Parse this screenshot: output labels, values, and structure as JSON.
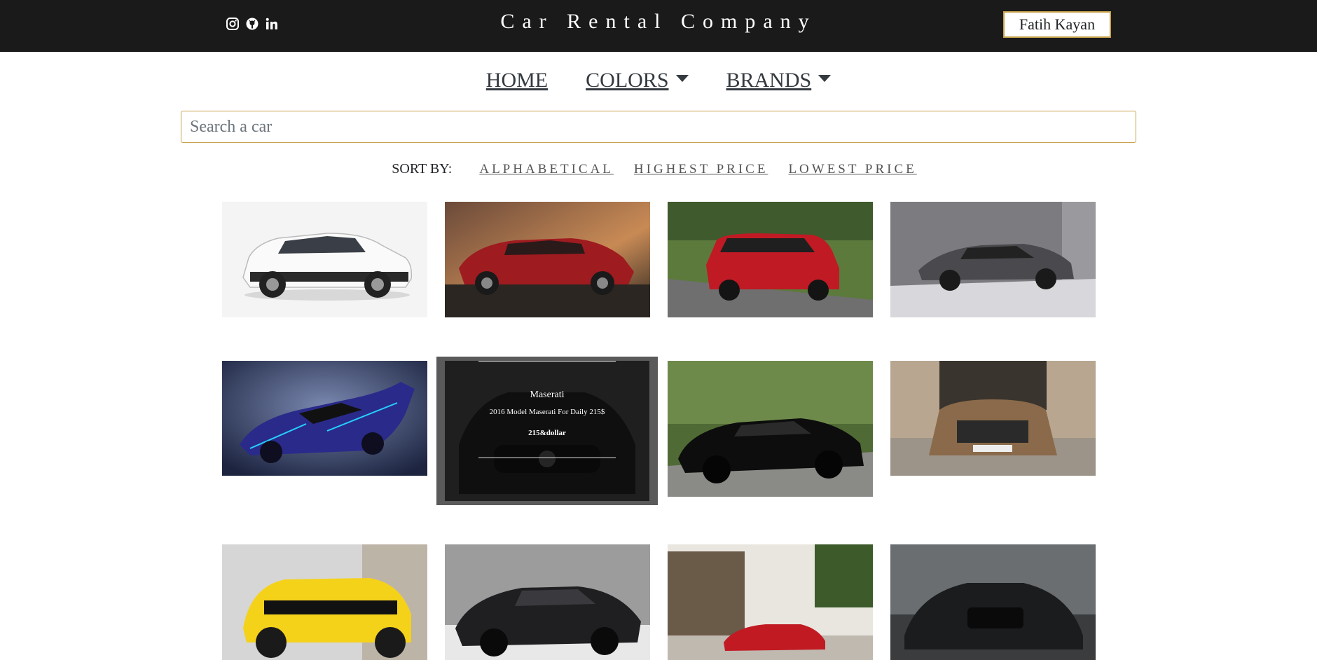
{
  "header": {
    "title": "Car Rental Company",
    "user_button": "Fatih Kayan",
    "social": [
      "instagram-icon",
      "github-icon",
      "linkedin-icon"
    ]
  },
  "nav": {
    "home": "HOME",
    "colors": "COLORS",
    "brands": "BRANDS"
  },
  "search": {
    "placeholder": "Search a car"
  },
  "sort": {
    "label": "SORT BY:",
    "options": [
      "ALPHABETICAL",
      "HIGHEST PRICE",
      "LOWEST PRICE"
    ]
  },
  "cars": [
    {
      "name": "volvo-white-suv"
    },
    {
      "name": "tesla-red-sedan"
    },
    {
      "name": "range-rover-red"
    },
    {
      "name": "mercedes-gray-coupe"
    },
    {
      "name": "blue-hypercar"
    },
    {
      "name": "maserati-black"
    },
    {
      "name": "mustang-black"
    },
    {
      "name": "ds-bronze-suv"
    },
    {
      "name": "camaro-yellow"
    },
    {
      "name": "bmw-i8-black"
    },
    {
      "name": "audi-red-sedan"
    },
    {
      "name": "audi-r8-black"
    }
  ],
  "hover_card": {
    "title": "Maserati",
    "description": "2016 Model Maserati For Daily 215$",
    "price": "215&dollar"
  },
  "colors": {
    "topbar": "#1a1a1a",
    "accent": "#c8a24a"
  }
}
